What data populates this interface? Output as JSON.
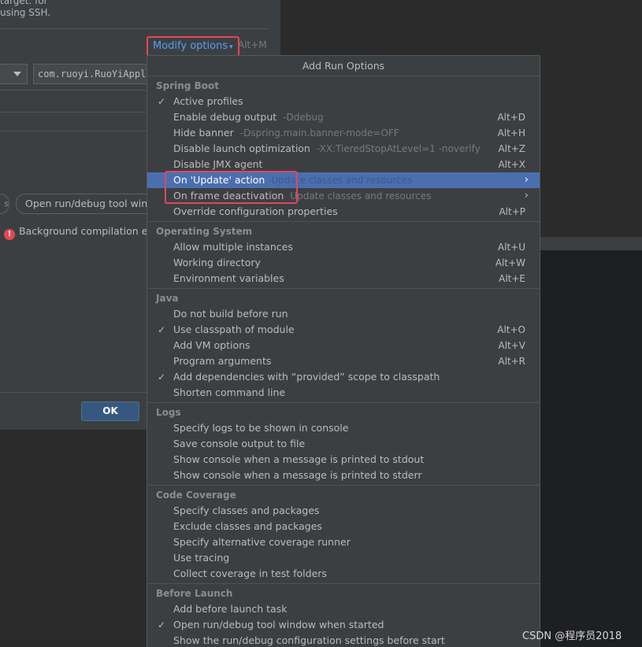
{
  "dialog": {
    "desc_lines": [
      "target. for",
      "using SSH."
    ],
    "modify_options_label": "Modify options",
    "modify_options_caret": "▾",
    "modify_options_shortcut": "Alt+M",
    "main_class_value": "com.ruoyi.RuoYiAppli",
    "chip_left_label": "s",
    "open_tool_window_chip": "Open run/debug tool windo",
    "warning_text": "Background compilation en",
    "ok_label": "OK"
  },
  "popup": {
    "title": "Add Run Options",
    "groups": [
      {
        "title": "Spring Boot",
        "items": [
          {
            "label": "Active profiles",
            "checked": true,
            "hint": "",
            "shortcut": ""
          },
          {
            "label": "Enable debug output",
            "checked": false,
            "hint": "-Ddebug",
            "shortcut": "Alt+D"
          },
          {
            "label": "Hide banner",
            "checked": false,
            "hint": "-Dspring.main.banner-mode=OFF",
            "shortcut": "Alt+H"
          },
          {
            "label": "Disable launch optimization",
            "checked": false,
            "hint": "-XX:TieredStopAtLevel=1 -noverify",
            "shortcut": "Alt+Z"
          },
          {
            "label": "Disable JMX agent",
            "checked": false,
            "hint": "",
            "shortcut": "Alt+X"
          },
          {
            "label": "On 'Update' action",
            "checked": false,
            "hint": "Update classes and resources",
            "shortcut": "",
            "submenu": true,
            "highlighted": true
          },
          {
            "label": "On frame deactivation",
            "checked": false,
            "hint": "Update classes and resources",
            "shortcut": "",
            "submenu": true
          },
          {
            "label": "Override configuration properties",
            "checked": false,
            "hint": "",
            "shortcut": "Alt+P"
          }
        ]
      },
      {
        "title": "Operating System",
        "items": [
          {
            "label": "Allow multiple instances",
            "checked": false,
            "hint": "",
            "shortcut": "Alt+U"
          },
          {
            "label": "Working directory",
            "checked": false,
            "hint": "",
            "shortcut": "Alt+W"
          },
          {
            "label": "Environment variables",
            "checked": false,
            "hint": "",
            "shortcut": "Alt+E"
          }
        ]
      },
      {
        "title": "Java",
        "items": [
          {
            "label": "Do not build before run",
            "checked": false,
            "hint": "",
            "shortcut": ""
          },
          {
            "label": "Use classpath of module",
            "checked": true,
            "hint": "",
            "shortcut": "Alt+O"
          },
          {
            "label": "Add VM options",
            "checked": false,
            "hint": "",
            "shortcut": "Alt+V"
          },
          {
            "label": "Program arguments",
            "checked": false,
            "hint": "",
            "shortcut": "Alt+R"
          },
          {
            "label": "Add dependencies with “provided” scope to classpath",
            "checked": true,
            "hint": "",
            "shortcut": ""
          },
          {
            "label": "Shorten command line",
            "checked": false,
            "hint": "",
            "shortcut": ""
          }
        ]
      },
      {
        "title": "Logs",
        "items": [
          {
            "label": "Specify logs to be shown in console",
            "checked": false,
            "hint": "",
            "shortcut": ""
          },
          {
            "label": "Save console output to file",
            "checked": false,
            "hint": "",
            "shortcut": ""
          },
          {
            "label": "Show console when a message is printed to stdout",
            "checked": false,
            "hint": "",
            "shortcut": ""
          },
          {
            "label": "Show console when a message is printed to stderr",
            "checked": false,
            "hint": "",
            "shortcut": ""
          }
        ]
      },
      {
        "title": "Code Coverage",
        "items": [
          {
            "label": "Specify classes and packages",
            "checked": false,
            "hint": "",
            "shortcut": ""
          },
          {
            "label": "Exclude classes and packages",
            "checked": false,
            "hint": "",
            "shortcut": ""
          },
          {
            "label": "Specify alternative coverage runner",
            "checked": false,
            "hint": "",
            "shortcut": ""
          },
          {
            "label": "Use tracing",
            "checked": false,
            "hint": "",
            "shortcut": ""
          },
          {
            "label": "Collect coverage in test folders",
            "checked": false,
            "hint": "",
            "shortcut": ""
          }
        ]
      },
      {
        "title": "Before Launch",
        "items": [
          {
            "label": "Add before launch task",
            "checked": false,
            "hint": "",
            "shortcut": ""
          },
          {
            "label": "Open run/debug tool window when started",
            "checked": true,
            "hint": "",
            "shortcut": ""
          },
          {
            "label": "Show the run/debug configuration settings before start",
            "checked": false,
            "hint": "",
            "shortcut": ""
          }
        ]
      }
    ]
  },
  "watermark": "CSDN @程序员2018",
  "colors": {
    "highlight": "#4b6eaf",
    "annotation_box": "#e0475c",
    "link": "#589df6",
    "ok_button": "#365880"
  }
}
